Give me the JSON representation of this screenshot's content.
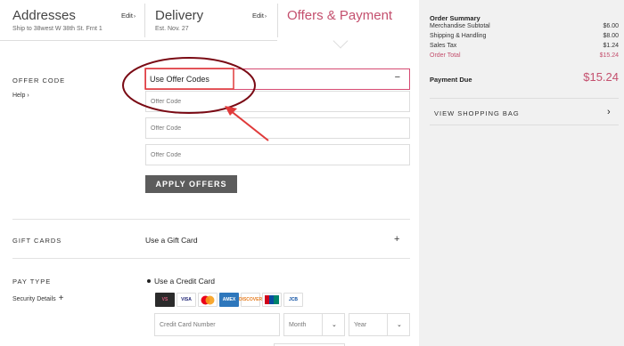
{
  "steps": [
    {
      "title": "Addresses",
      "subtitle": "Ship to 38west W 38th St. Frnt 1",
      "edit": "Edit"
    },
    {
      "title": "Delivery",
      "subtitle": "Est. Nov. 27",
      "edit": "Edit"
    },
    {
      "title": "Offers & Payment"
    }
  ],
  "offer": {
    "section_label": "OFFER CODE",
    "help": "Help",
    "header": "Use Offer Codes",
    "collapse_symbol": "−",
    "inputs": [
      "Offer Code",
      "Offer Code",
      "Offer Code"
    ],
    "apply_label": "APPLY OFFERS"
  },
  "gift": {
    "section_label": "GIFT CARDS",
    "label": "Use a Gift Card",
    "expand_symbol": "+"
  },
  "pay": {
    "section_label": "PAY TYPE",
    "security": "Security Details",
    "option": "Use a Credit Card",
    "cards": [
      {
        "name": "VS",
        "bg": "#2b2b2b",
        "fg": "#d55a7a"
      },
      {
        "name": "VISA",
        "bg": "#ffffff",
        "fg": "#1a1f71"
      },
      {
        "name": "MC",
        "bg": "#ffffff",
        "fg": "#eb001b"
      },
      {
        "name": "AMEX",
        "bg": "#2e77bc",
        "fg": "#ffffff"
      },
      {
        "name": "DISCOVER",
        "bg": "#ffffff",
        "fg": "#e67e22"
      },
      {
        "name": "UP",
        "bg": "#ffffff",
        "fg": "#d0021b"
      },
      {
        "name": "JCB",
        "bg": "#ffffff",
        "fg": "#0b4ea2"
      }
    ],
    "card_number_placeholder": "Credit Card Number",
    "month_placeholder": "Month",
    "year_placeholder": "Year"
  },
  "summary": {
    "title": "Order Summary",
    "rows": [
      {
        "label": "Merchandise Subtotal",
        "value": "$6.00"
      },
      {
        "label": "Shipping & Handling",
        "value": "$8.00"
      },
      {
        "label": "Sales Tax",
        "value": "$1.24"
      },
      {
        "label": "Order Total",
        "value": "$15.24"
      }
    ],
    "payment_due_label": "Payment Due",
    "payment_due_value": "$15.24",
    "view_bag": "VIEW SHOPPING BAG"
  },
  "colors": {
    "accent": "#c4506e",
    "annotation": "#7a0a14",
    "arrow": "#e03a3a"
  }
}
